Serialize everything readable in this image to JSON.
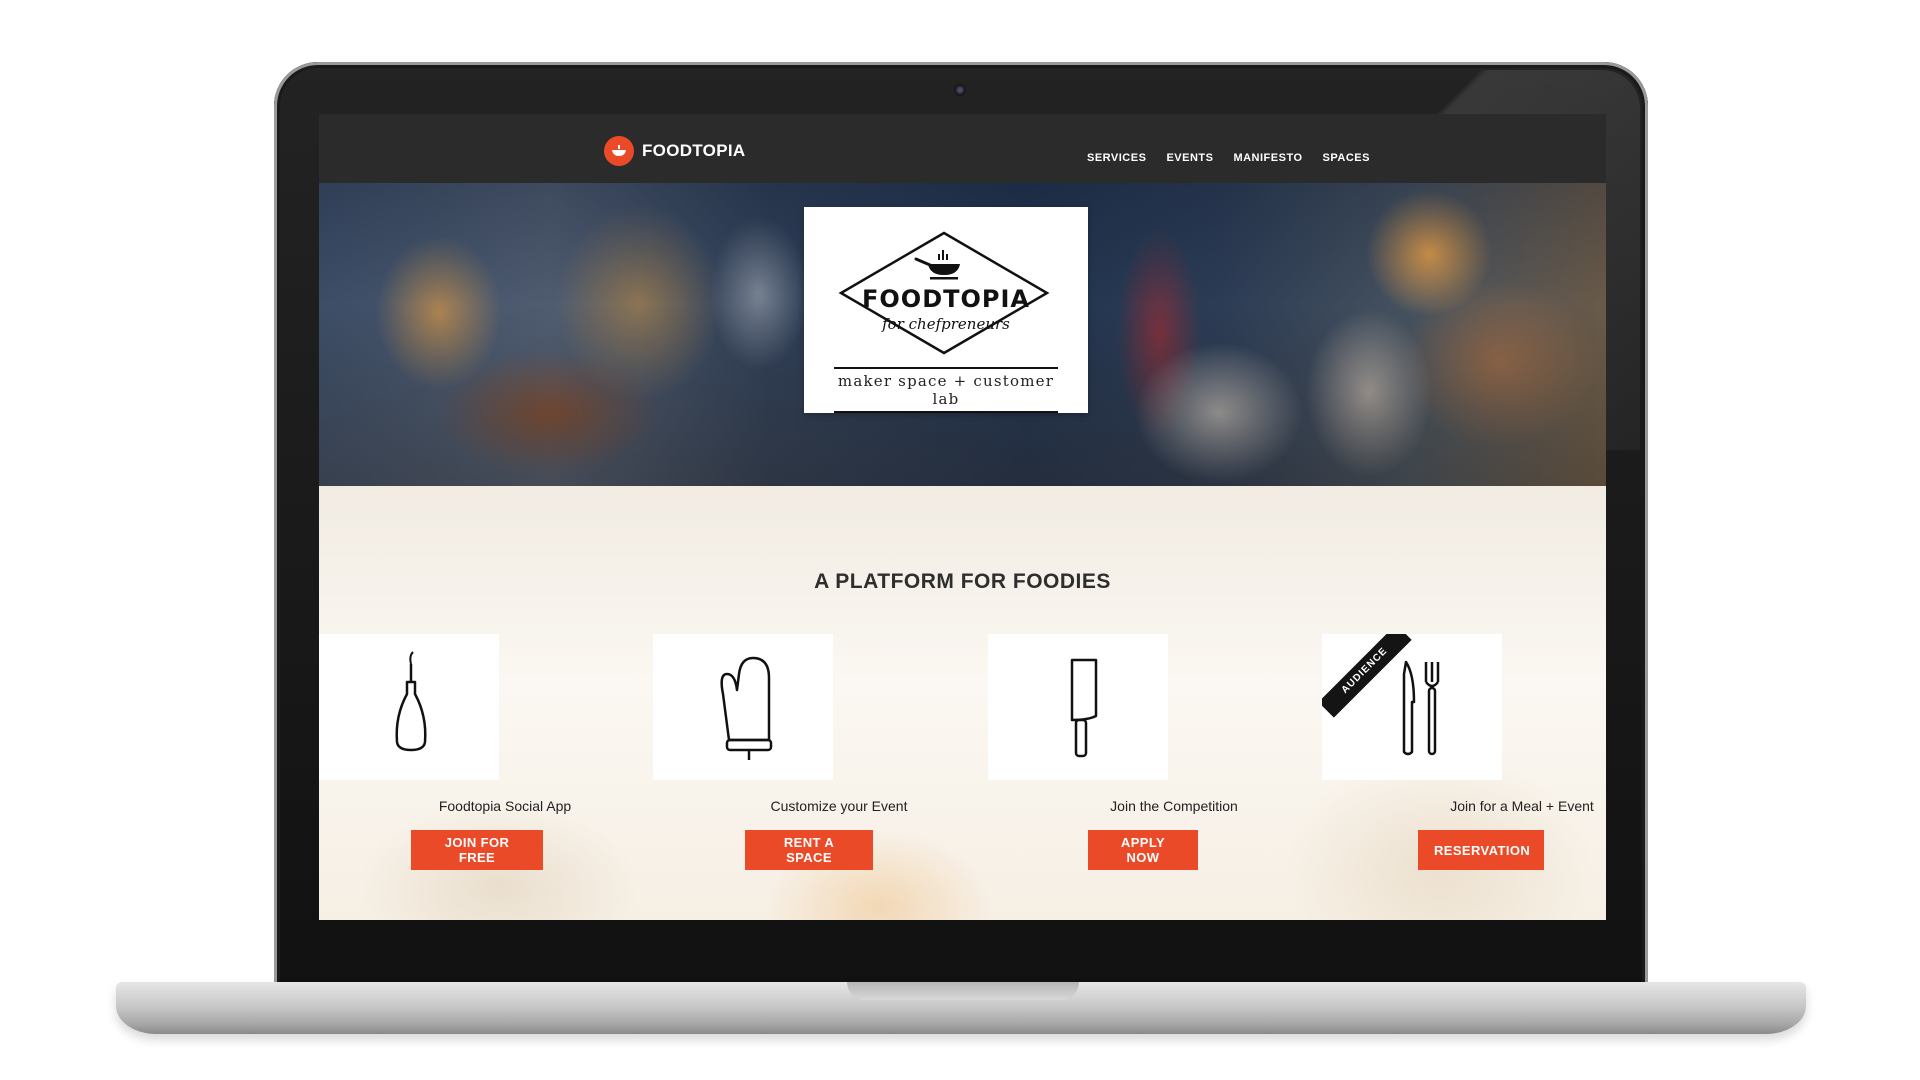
{
  "navbar": {
    "logo_text": "FOODTOPIA",
    "links": [
      "SERVICES",
      "EVENTS",
      "MANIFESTO",
      "SPACES"
    ]
  },
  "hero": {
    "title": "FOODTOPIA",
    "script": "for chefpreneurs",
    "tagline": "maker space + customer lab"
  },
  "section": {
    "title": "A PLATFORM FOR FOODIES"
  },
  "features": [
    {
      "label": "Foodtopia Social App",
      "button": "JOIN FOR FREE",
      "icon": "oil-bottle-icon"
    },
    {
      "label": "Customize your Event",
      "button": "RENT A SPACE",
      "icon": "oven-mitt-icon"
    },
    {
      "label": "Join the Competition",
      "button": "APPLY NOW",
      "icon": "cleaver-icon"
    },
    {
      "label": "Join for a Meal + Event",
      "button": "RESERVATION",
      "icon": "knife-fork-icon",
      "ribbon": "AUDIENCE"
    }
  ],
  "colors": {
    "accent": "#ea4a28",
    "navbar": "#2b2b2b"
  }
}
